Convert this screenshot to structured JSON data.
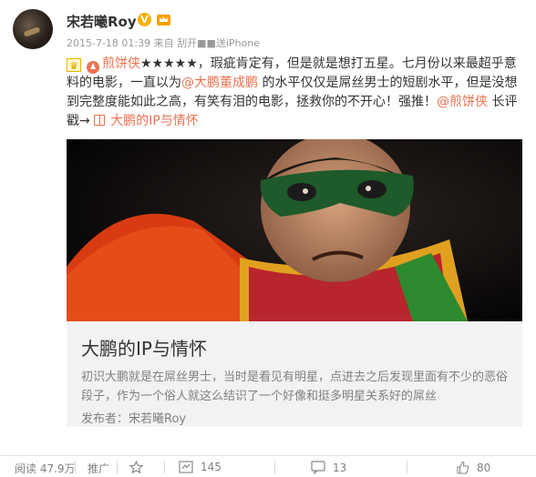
{
  "post": {
    "username": "宋若曦Roy",
    "verified_badge": "V",
    "meta": "2015-7-18 01:39 来自 刮开■■送iPhone",
    "text": {
      "icon": "trophy-icon",
      "movie_link": "煎饼侠",
      "rating": "★★★★★",
      "p1": "，瑕疵肯定有，但是就是想打五星。七月份以来最超乎意料的电影，一直以为",
      "mention1": "@大鹏董成鹏",
      "p2": " 的水平仅仅是屌丝男士的短剧水平，但是没想到完整度能如此之高，有笑有泪的电影，拯救你的不开心！强推！",
      "mention2": "@煎饼侠",
      "p3": " 长评戳→ ",
      "article_link": "大鹏的IP与情怀"
    },
    "card": {
      "title": "大鹏的IP与情怀",
      "description": "初识大鹏就是在屌丝男士，当时是看见有明星，点进去之后发现里面有不少的恶俗段子，作为一个俗人就这么结识了一个好像和挺多明星关系好的屌丝",
      "author": "发布者：宋若曦Roy"
    }
  },
  "footer": {
    "reads": "阅读 47.9万",
    "promote": "推广",
    "favorite": "",
    "reposts": "145",
    "comments": "13",
    "likes": "80"
  }
}
